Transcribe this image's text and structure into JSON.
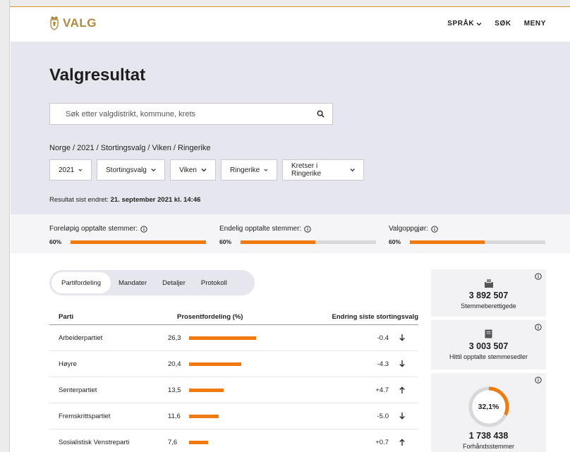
{
  "header": {
    "logo_text": "VALG",
    "nav": [
      {
        "label": "SPRÅK",
        "has_chevron": true
      },
      {
        "label": "SØK",
        "has_chevron": false
      },
      {
        "label": "MENY",
        "has_chevron": false
      }
    ]
  },
  "hero": {
    "title": "Valgresultat",
    "search_placeholder": "Søk etter valgdistrikt, kommune, krets",
    "breadcrumb": "Norge / 2021 / Stortingsvalg / Viken / Ringerike",
    "filters": [
      {
        "label": "2021"
      },
      {
        "label": "Stortingsvalg"
      },
      {
        "label": "Viken"
      },
      {
        "label": "Ringerike"
      },
      {
        "label": "Kretser i Ringerike"
      }
    ],
    "updated_prefix": "Resultat sist endret:",
    "updated_value": "21. september 2021 kl. 14:46"
  },
  "progress": [
    {
      "label": "Foreløpig opptalte stemmer:",
      "pct_text": "60%",
      "fill": 1.0
    },
    {
      "label": "Endelig opptalte stemmer:",
      "pct_text": "60%",
      "fill": 0.55
    },
    {
      "label": "Valgoppgjør:",
      "pct_text": "60%",
      "fill": 0.55
    }
  ],
  "tabs": [
    {
      "label": "Partifordeling",
      "active": true
    },
    {
      "label": "Mandater",
      "active": false
    },
    {
      "label": "Detaljer",
      "active": false
    },
    {
      "label": "Protokoll",
      "active": false
    }
  ],
  "table": {
    "headers": {
      "party": "Parti",
      "pct": "Prosentfordeling (%)",
      "change": "Endring siste stortingsvalg"
    },
    "rows": [
      {
        "party": "Arbeiderpartiet",
        "pct": "26,3",
        "value": 26.3,
        "change": "-0.4",
        "direction": "down"
      },
      {
        "party": "Høyre",
        "pct": "20,4",
        "value": 20.4,
        "change": "-4.3",
        "direction": "down"
      },
      {
        "party": "Senterpartiet",
        "pct": "13,5",
        "value": 13.5,
        "change": "+4.7",
        "direction": "up"
      },
      {
        "party": "Fremskrittspartiet",
        "pct": "11,6",
        "value": 11.6,
        "change": "-5.0",
        "direction": "down"
      },
      {
        "party": "Sosialistisk Venstreparti",
        "pct": "7,6",
        "value": 7.6,
        "change": "+0.7",
        "direction": "up"
      }
    ]
  },
  "cards": [
    {
      "value": "3 892 507",
      "label": "Stemmeberettigede",
      "icon": "ballot-box-icon"
    },
    {
      "value": "3 003 507",
      "label": "Hittil opptalte stemmesedler",
      "icon": "ballot-paper-icon"
    },
    {
      "value": "1 738 438",
      "label": "Forhåndsstemmer",
      "donut_text": "32,1%",
      "donut_fraction": 0.321
    }
  ],
  "colors": {
    "accent": "#f07a10",
    "hero_bg": "#e6e6ee",
    "logo": "#b08a3c"
  }
}
